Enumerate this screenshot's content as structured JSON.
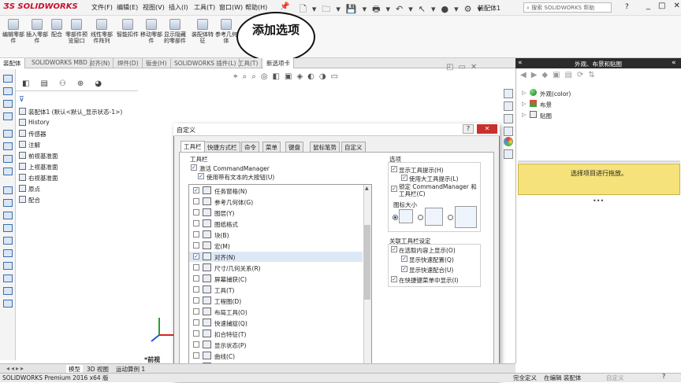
{
  "app": {
    "logo": "SOLIDWORKS",
    "doc_title": "装配体1",
    "search_placeholder": "搜索 SOLIDWORKS 帮助",
    "help": "?"
  },
  "menus": [
    "文件(F)",
    "编辑(E)",
    "视图(V)",
    "插入(I)",
    "工具(T)",
    "窗口(W)",
    "帮助(H)"
  ],
  "ribbon": [
    {
      "label": "编辑零部件",
      "icon": "edit-component-icon"
    },
    {
      "label": "插入零部件",
      "icon": "insert-component-icon"
    },
    {
      "label": "配合",
      "icon": "mate-icon"
    },
    {
      "label": "零部件预览窗口",
      "icon": "preview-window-icon"
    },
    {
      "label": "线性零部件阵列",
      "icon": "linear-pattern-icon"
    },
    {
      "label": "智能扣件",
      "icon": "smart-fastener-icon"
    },
    {
      "label": "移动零部件",
      "icon": "move-component-icon"
    },
    {
      "label": "显示隐藏的零部件",
      "icon": "show-hidden-icon"
    },
    {
      "label": "装配体特征",
      "icon": "assembly-feature-icon"
    },
    {
      "label": "参考几何体",
      "icon": "reference-geometry-icon"
    }
  ],
  "callout": "添加选项",
  "tabs": [
    "装配体",
    "SOLIDWORKS MBD",
    "对齐(N)",
    "焊件(D)",
    "钣金(H)",
    "SOLIDWORKS 插件(L)",
    "工具(T)",
    "新选项卡"
  ],
  "tree": {
    "root": "装配体1 (默认<默认_显示状态-1>)",
    "items": [
      "History",
      "传感器",
      "注解",
      "前视基准面",
      "上视基准面",
      "右视基准面",
      "原点",
      "配合"
    ]
  },
  "view_label": "*前视",
  "dialog": {
    "title": "自定义",
    "help": "?",
    "close": "✕",
    "tabs": [
      "工具栏",
      "快捷方式栏",
      "命令",
      "菜单",
      "键盘",
      "鼠标笔势",
      "自定义"
    ],
    "toolbar_group": "工具栏",
    "activate_cm": "激活 CommandManager",
    "use_large_buttons": "使用带有文本的大按钮(U)",
    "toolbars": [
      {
        "label": "任务窗格(N)",
        "checked": true
      },
      {
        "label": "参考几何体(G)",
        "checked": false
      },
      {
        "label": "图层(Y)",
        "checked": false
      },
      {
        "label": "图纸格式",
        "checked": false
      },
      {
        "label": "块(B)",
        "checked": false
      },
      {
        "label": "宏(M)",
        "checked": false
      },
      {
        "label": "对齐(N)",
        "checked": true
      },
      {
        "label": "尺寸/几何关系(R)",
        "checked": false
      },
      {
        "label": "屏幕捕获(C)",
        "checked": false
      },
      {
        "label": "工具(T)",
        "checked": false
      },
      {
        "label": "工程图(D)",
        "checked": false
      },
      {
        "label": "布局工具(O)",
        "checked": false
      },
      {
        "label": "快速捕捉(Q)",
        "checked": false
      },
      {
        "label": "扣合特征(T)",
        "checked": false
      },
      {
        "label": "显示状态(P)",
        "checked": false
      },
      {
        "label": "曲线(C)",
        "checked": false
      },
      {
        "label": "曲面(E)",
        "checked": false
      },
      {
        "label": "标注(S)",
        "checked": false
      }
    ],
    "options_group": "选项",
    "show_tooltips": "显示工具提示(H)",
    "use_large_tooltips": "使用大工具提示(L)",
    "lock_cm": "锁定 CommandManager 和工具栏(C)",
    "icon_size": "图标大小",
    "context_group": "关联工具栏设定",
    "show_in_selection": "在选取内容上显示(O)",
    "show_quick_config": "显示快速配置(Q)",
    "show_quick_mate": "显示快速配合(U)",
    "show_in_shortcut": "在快捷键菜单中显示(I)"
  },
  "right_panel": {
    "title": "外观、布景和贴图",
    "items": [
      "外观(color)",
      "布景",
      "贴图"
    ],
    "hint": "选择项目进行拖放。"
  },
  "bottom_tabs": [
    "模型",
    "3D 视图",
    "运动算例 1"
  ],
  "status": {
    "left": "SOLIDWORKS Premium 2016 x64 版",
    "defined": "完全定义",
    "editing": "在编辑 装配体",
    "custom": "自定义"
  }
}
